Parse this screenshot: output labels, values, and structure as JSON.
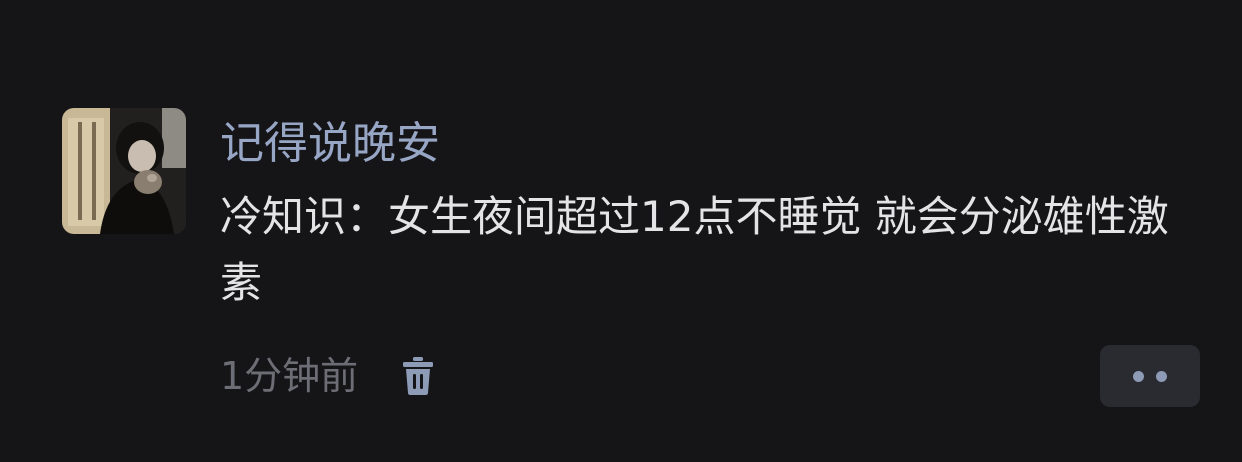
{
  "post": {
    "username": "记得说晚安",
    "message": "冷知识：女生夜间超过12点不睡觉 就会分泌雄性激素",
    "timestamp": "1分钟前"
  },
  "icons": {
    "avatar": "user-avatar-photo",
    "delete": "trash-icon",
    "more": "more-dots-icon"
  },
  "colors": {
    "background": "#151518",
    "username": "#98a6c6",
    "message": "#e4e4e6",
    "timestamp": "#6d6e75",
    "accent_icon": "#8e9bb7",
    "button_bg": "#2a2b30"
  }
}
